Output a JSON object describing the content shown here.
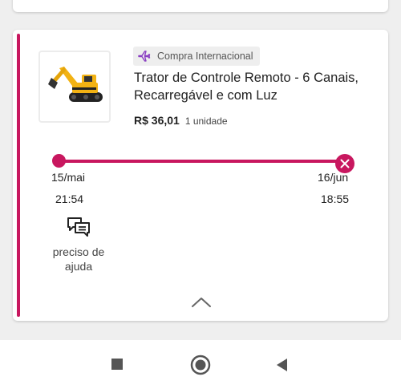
{
  "badge": {
    "label": "Compra Internacional",
    "icon": "airplane-icon"
  },
  "product": {
    "title": "Trator de Controle Remoto - 6 Canais, Recarregável e com Luz",
    "price": "R$ 36,01",
    "quantity": "1 unidade",
    "image": "excavator-toy-image"
  },
  "timeline": {
    "start_date": "15/mai",
    "start_time": "21:54",
    "end_date": "16/jun",
    "end_time": "18:55",
    "status": "cancelled",
    "accent_color": "#c8175f"
  },
  "help": {
    "label": "preciso de ajuda",
    "icon": "chat-icon"
  },
  "navigation": {
    "recents": "square-icon",
    "home": "circle-icon",
    "back": "triangle-back-icon"
  }
}
